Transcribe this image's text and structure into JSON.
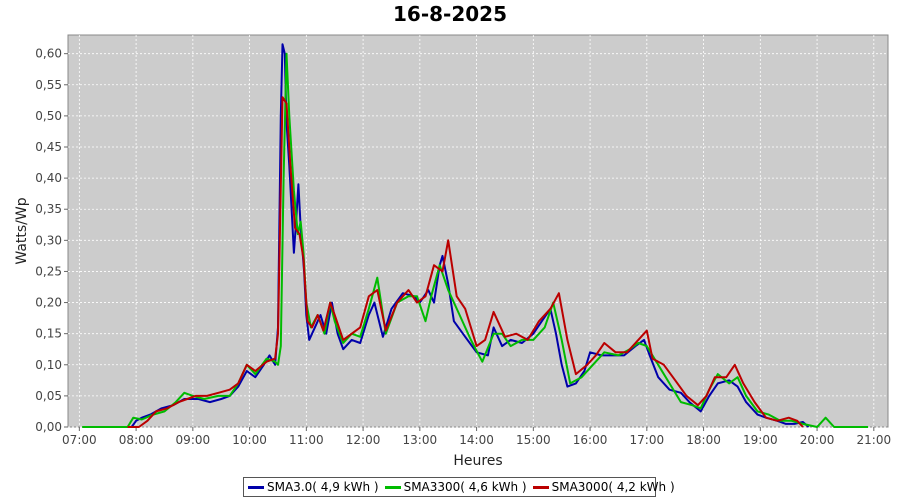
{
  "chart_data": {
    "type": "line",
    "title": "16-8-2025",
    "xlabel": "Heures",
    "ylabel": "Watts/Wp",
    "xlim": [
      6.8,
      21.25
    ],
    "ylim": [
      0,
      0.63
    ],
    "x_ticks": [
      "07:00",
      "08:00",
      "09:00",
      "10:00",
      "11:00",
      "12:00",
      "13:00",
      "14:00",
      "15:00",
      "16:00",
      "17:00",
      "18:00",
      "19:00",
      "20:00",
      "21:00"
    ],
    "y_ticks": [
      "0,00",
      "0,05",
      "0,10",
      "0,15",
      "0,20",
      "0,25",
      "0,30",
      "0,35",
      "0,40",
      "0,45",
      "0,50",
      "0,55",
      "0,60"
    ],
    "grid": true,
    "legend_position": "bottom",
    "series": [
      {
        "name": "SMA3.0( 4,9 kWh )",
        "color": "#0000aa",
        "points": [
          [
            7.8,
            0.0
          ],
          [
            7.92,
            0.0
          ],
          [
            8.0,
            0.01
          ],
          [
            8.1,
            0.015
          ],
          [
            8.25,
            0.02
          ],
          [
            8.45,
            0.03
          ],
          [
            8.65,
            0.035
          ],
          [
            8.85,
            0.045
          ],
          [
            9.1,
            0.045
          ],
          [
            9.3,
            0.04
          ],
          [
            9.5,
            0.045
          ],
          [
            9.65,
            0.05
          ],
          [
            9.8,
            0.065
          ],
          [
            9.95,
            0.09
          ],
          [
            10.1,
            0.08
          ],
          [
            10.25,
            0.1
          ],
          [
            10.35,
            0.115
          ],
          [
            10.45,
            0.1
          ],
          [
            10.5,
            0.16
          ],
          [
            10.55,
            0.5
          ],
          [
            10.58,
            0.615
          ],
          [
            10.62,
            0.6
          ],
          [
            10.65,
            0.49
          ],
          [
            10.7,
            0.42
          ],
          [
            10.78,
            0.28
          ],
          [
            10.82,
            0.33
          ],
          [
            10.86,
            0.39
          ],
          [
            10.9,
            0.32
          ],
          [
            10.96,
            0.25
          ],
          [
            11.0,
            0.18
          ],
          [
            11.05,
            0.14
          ],
          [
            11.15,
            0.16
          ],
          [
            11.25,
            0.18
          ],
          [
            11.35,
            0.15
          ],
          [
            11.45,
            0.2
          ],
          [
            11.55,
            0.15
          ],
          [
            11.65,
            0.125
          ],
          [
            11.8,
            0.14
          ],
          [
            11.95,
            0.135
          ],
          [
            12.1,
            0.18
          ],
          [
            12.2,
            0.2
          ],
          [
            12.35,
            0.145
          ],
          [
            12.5,
            0.19
          ],
          [
            12.7,
            0.215
          ],
          [
            12.9,
            0.21
          ],
          [
            13.0,
            0.2
          ],
          [
            13.15,
            0.22
          ],
          [
            13.25,
            0.2
          ],
          [
            13.35,
            0.26
          ],
          [
            13.4,
            0.275
          ],
          [
            13.5,
            0.23
          ],
          [
            13.6,
            0.17
          ],
          [
            13.8,
            0.145
          ],
          [
            14.0,
            0.12
          ],
          [
            14.2,
            0.115
          ],
          [
            14.3,
            0.16
          ],
          [
            14.45,
            0.13
          ],
          [
            14.6,
            0.14
          ],
          [
            14.8,
            0.135
          ],
          [
            15.0,
            0.15
          ],
          [
            15.15,
            0.17
          ],
          [
            15.3,
            0.19
          ],
          [
            15.4,
            0.15
          ],
          [
            15.5,
            0.1
          ],
          [
            15.6,
            0.065
          ],
          [
            15.75,
            0.07
          ],
          [
            15.9,
            0.09
          ],
          [
            16.0,
            0.12
          ],
          [
            16.2,
            0.115
          ],
          [
            16.4,
            0.115
          ],
          [
            16.6,
            0.115
          ],
          [
            16.8,
            0.13
          ],
          [
            16.95,
            0.14
          ],
          [
            17.05,
            0.115
          ],
          [
            17.2,
            0.08
          ],
          [
            17.4,
            0.06
          ],
          [
            17.6,
            0.055
          ],
          [
            17.75,
            0.04
          ],
          [
            17.95,
            0.025
          ],
          [
            18.1,
            0.05
          ],
          [
            18.25,
            0.07
          ],
          [
            18.45,
            0.075
          ],
          [
            18.6,
            0.065
          ],
          [
            18.75,
            0.04
          ],
          [
            18.95,
            0.02
          ],
          [
            19.1,
            0.015
          ],
          [
            19.3,
            0.01
          ],
          [
            19.45,
            0.005
          ],
          [
            19.6,
            0.005
          ],
          [
            19.75,
            0.008
          ],
          [
            19.85,
            0.0
          ]
        ]
      },
      {
        "name": "SMA3300( 4,6 kWh )",
        "color": "#00bb00",
        "points": [
          [
            7.05,
            0.0
          ],
          [
            7.85,
            0.0
          ],
          [
            7.95,
            0.015
          ],
          [
            8.1,
            0.012
          ],
          [
            8.3,
            0.02
          ],
          [
            8.5,
            0.025
          ],
          [
            8.7,
            0.04
          ],
          [
            8.85,
            0.055
          ],
          [
            9.0,
            0.05
          ],
          [
            9.2,
            0.045
          ],
          [
            9.45,
            0.05
          ],
          [
            9.65,
            0.05
          ],
          [
            9.8,
            0.07
          ],
          [
            9.95,
            0.1
          ],
          [
            10.1,
            0.085
          ],
          [
            10.3,
            0.11
          ],
          [
            10.45,
            0.105
          ],
          [
            10.5,
            0.1
          ],
          [
            10.55,
            0.13
          ],
          [
            10.6,
            0.4
          ],
          [
            10.65,
            0.6
          ],
          [
            10.7,
            0.5
          ],
          [
            10.78,
            0.38
          ],
          [
            10.85,
            0.31
          ],
          [
            10.9,
            0.33
          ],
          [
            10.95,
            0.28
          ],
          [
            11.0,
            0.2
          ],
          [
            11.08,
            0.16
          ],
          [
            11.2,
            0.18
          ],
          [
            11.32,
            0.15
          ],
          [
            11.42,
            0.2
          ],
          [
            11.5,
            0.17
          ],
          [
            11.65,
            0.135
          ],
          [
            11.8,
            0.15
          ],
          [
            11.95,
            0.145
          ],
          [
            12.1,
            0.19
          ],
          [
            12.25,
            0.24
          ],
          [
            12.4,
            0.15
          ],
          [
            12.6,
            0.2
          ],
          [
            12.8,
            0.21
          ],
          [
            12.95,
            0.21
          ],
          [
            13.1,
            0.17
          ],
          [
            13.2,
            0.21
          ],
          [
            13.35,
            0.26
          ],
          [
            13.5,
            0.22
          ],
          [
            13.7,
            0.18
          ],
          [
            13.9,
            0.14
          ],
          [
            14.1,
            0.105
          ],
          [
            14.3,
            0.15
          ],
          [
            14.45,
            0.15
          ],
          [
            14.6,
            0.13
          ],
          [
            14.8,
            0.14
          ],
          [
            15.0,
            0.14
          ],
          [
            15.2,
            0.16
          ],
          [
            15.35,
            0.2
          ],
          [
            15.5,
            0.14
          ],
          [
            15.65,
            0.07
          ],
          [
            15.85,
            0.08
          ],
          [
            16.05,
            0.1
          ],
          [
            16.25,
            0.12
          ],
          [
            16.5,
            0.115
          ],
          [
            16.7,
            0.125
          ],
          [
            16.85,
            0.135
          ],
          [
            17.0,
            0.13
          ],
          [
            17.2,
            0.1
          ],
          [
            17.4,
            0.07
          ],
          [
            17.6,
            0.04
          ],
          [
            17.8,
            0.035
          ],
          [
            17.95,
            0.03
          ],
          [
            18.1,
            0.06
          ],
          [
            18.25,
            0.085
          ],
          [
            18.45,
            0.07
          ],
          [
            18.6,
            0.08
          ],
          [
            18.75,
            0.05
          ],
          [
            18.95,
            0.025
          ],
          [
            19.15,
            0.02
          ],
          [
            19.35,
            0.01
          ],
          [
            19.55,
            0.01
          ],
          [
            19.75,
            0.005
          ],
          [
            20.0,
            0.0
          ],
          [
            20.15,
            0.015
          ],
          [
            20.3,
            0.0
          ],
          [
            20.9,
            0.0
          ]
        ]
      },
      {
        "name": "SMA3000( 4,2 kWh )",
        "color": "#bb0000",
        "points": [
          [
            7.85,
            0.0
          ],
          [
            8.05,
            0.0
          ],
          [
            8.2,
            0.01
          ],
          [
            8.35,
            0.025
          ],
          [
            8.55,
            0.03
          ],
          [
            8.75,
            0.04
          ],
          [
            8.9,
            0.045
          ],
          [
            9.05,
            0.05
          ],
          [
            9.25,
            0.05
          ],
          [
            9.45,
            0.055
          ],
          [
            9.65,
            0.06
          ],
          [
            9.8,
            0.07
          ],
          [
            9.95,
            0.1
          ],
          [
            10.1,
            0.09
          ],
          [
            10.3,
            0.105
          ],
          [
            10.45,
            0.11
          ],
          [
            10.5,
            0.15
          ],
          [
            10.58,
            0.53
          ],
          [
            10.65,
            0.52
          ],
          [
            10.72,
            0.42
          ],
          [
            10.8,
            0.32
          ],
          [
            10.88,
            0.31
          ],
          [
            10.95,
            0.27
          ],
          [
            11.02,
            0.17
          ],
          [
            11.1,
            0.16
          ],
          [
            11.2,
            0.18
          ],
          [
            11.3,
            0.155
          ],
          [
            11.42,
            0.2
          ],
          [
            11.5,
            0.18
          ],
          [
            11.65,
            0.14
          ],
          [
            11.8,
            0.15
          ],
          [
            11.95,
            0.16
          ],
          [
            12.1,
            0.21
          ],
          [
            12.25,
            0.22
          ],
          [
            12.4,
            0.155
          ],
          [
            12.6,
            0.2
          ],
          [
            12.8,
            0.22
          ],
          [
            12.95,
            0.2
          ],
          [
            13.1,
            0.21
          ],
          [
            13.25,
            0.26
          ],
          [
            13.4,
            0.25
          ],
          [
            13.5,
            0.3
          ],
          [
            13.65,
            0.21
          ],
          [
            13.8,
            0.19
          ],
          [
            14.0,
            0.13
          ],
          [
            14.15,
            0.14
          ],
          [
            14.3,
            0.185
          ],
          [
            14.5,
            0.145
          ],
          [
            14.7,
            0.15
          ],
          [
            14.9,
            0.14
          ],
          [
            15.1,
            0.17
          ],
          [
            15.3,
            0.19
          ],
          [
            15.45,
            0.215
          ],
          [
            15.6,
            0.14
          ],
          [
            15.75,
            0.085
          ],
          [
            15.95,
            0.1
          ],
          [
            16.1,
            0.115
          ],
          [
            16.25,
            0.135
          ],
          [
            16.45,
            0.12
          ],
          [
            16.65,
            0.12
          ],
          [
            16.85,
            0.14
          ],
          [
            17.0,
            0.155
          ],
          [
            17.1,
            0.11
          ],
          [
            17.3,
            0.1
          ],
          [
            17.5,
            0.075
          ],
          [
            17.7,
            0.05
          ],
          [
            17.9,
            0.035
          ],
          [
            18.05,
            0.05
          ],
          [
            18.2,
            0.08
          ],
          [
            18.4,
            0.08
          ],
          [
            18.55,
            0.1
          ],
          [
            18.7,
            0.07
          ],
          [
            18.9,
            0.04
          ],
          [
            19.1,
            0.015
          ],
          [
            19.3,
            0.01
          ],
          [
            19.5,
            0.015
          ],
          [
            19.65,
            0.01
          ],
          [
            19.75,
            0.0
          ]
        ]
      }
    ]
  }
}
